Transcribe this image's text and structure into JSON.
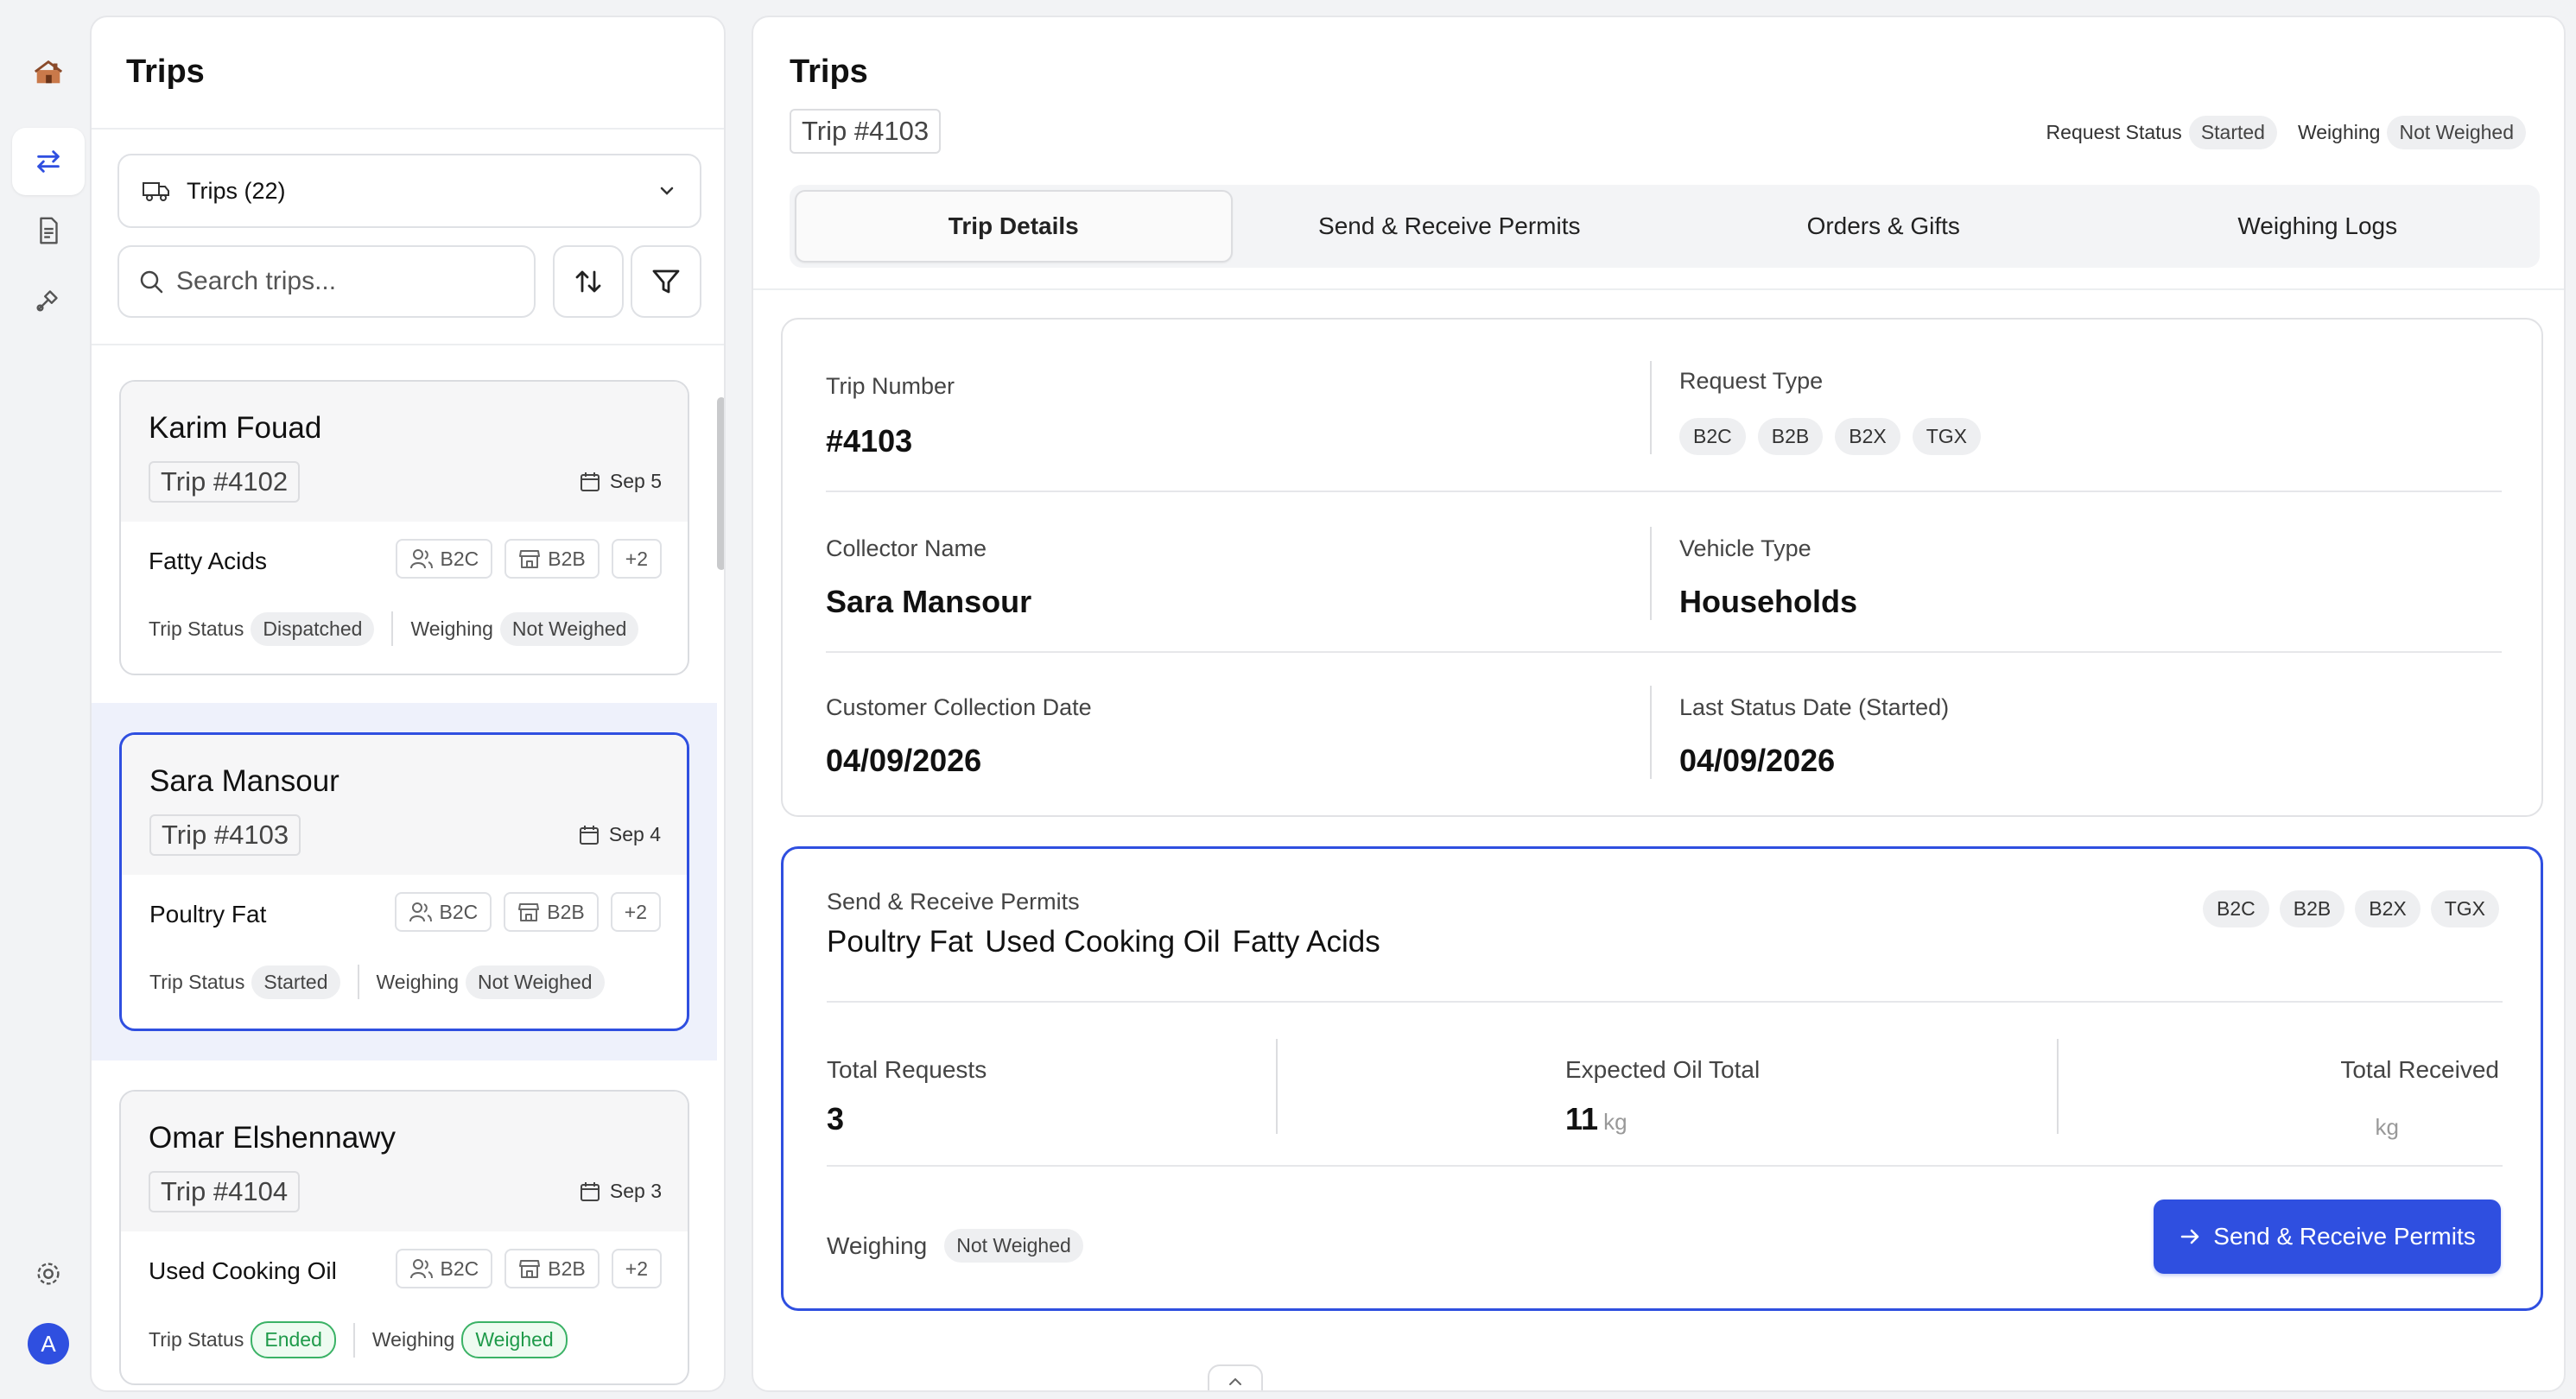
{
  "left": {
    "title": "Trips",
    "dropdown_label": "Trips (22)",
    "search_placeholder": "Search trips..."
  },
  "cards": [
    {
      "name": "Karim Fouad",
      "trip": "Trip #4102",
      "date": "Sep 5",
      "material": "Fatty Acids",
      "tags": [
        "B2C",
        "B2B",
        "+2"
      ],
      "status_label": "Trip Status",
      "status": "Dispatched",
      "weigh_label": "Weighing",
      "weigh": "Not Weighed"
    },
    {
      "name": "Sara Mansour",
      "trip": "Trip #4103",
      "date": "Sep 4",
      "material": "Poultry Fat",
      "tags": [
        "B2C",
        "B2B",
        "+2"
      ],
      "status_label": "Trip Status",
      "status": "Started",
      "weigh_label": "Weighing",
      "weigh": "Not Weighed"
    },
    {
      "name": "Omar Elshennawy",
      "trip": "Trip #4104",
      "date": "Sep 3",
      "material": "Used Cooking Oil",
      "tags": [
        "B2C",
        "B2B",
        "+2"
      ],
      "status_label": "Trip Status",
      "status": "Ended",
      "weigh_label": "Weighing",
      "weigh": "Weighed"
    }
  ],
  "main": {
    "title": "Trips",
    "trip": "Trip #4103",
    "request_status_label": "Request Status",
    "request_status": "Started",
    "weighing_label": "Weighing",
    "weighing": "Not Weighed",
    "tabs": [
      "Trip Details",
      "Send & Receive Permits",
      "Orders & Gifts",
      "Weighing Logs"
    ]
  },
  "details": {
    "trip_number_label": "Trip Number",
    "trip_number": "#4103",
    "request_type_label": "Request Type",
    "request_types": [
      "B2C",
      "B2B",
      "B2X",
      "TGX"
    ],
    "collector_label": "Collector Name",
    "collector": "Sara Mansour",
    "vehicle_label": "Vehicle Type",
    "vehicle": "Households",
    "collection_date_label": "Customer Collection Date",
    "collection_date": "04/09/2026",
    "last_status_label": "Last Status Date (Started)",
    "last_status_date": "04/09/2026"
  },
  "permits": {
    "subtitle": "Send & Receive Permits",
    "materials": [
      "Poultry Fat",
      "Used Cooking Oil",
      "Fatty Acids"
    ],
    "chips": [
      "B2C",
      "B2B",
      "B2X",
      "TGX"
    ],
    "total_requests_label": "Total Requests",
    "total_requests": "3",
    "expected_label": "Expected Oil Total",
    "expected": "11",
    "unit": "kg",
    "received_label": "Total Received",
    "weighing_label": "Weighing",
    "weighing": "Not Weighed",
    "button": "Send & Receive Permits"
  },
  "rail": {
    "avatar": "A"
  },
  "colors": {
    "accent": "#2f4fe0",
    "success": "#1f9a4a"
  }
}
